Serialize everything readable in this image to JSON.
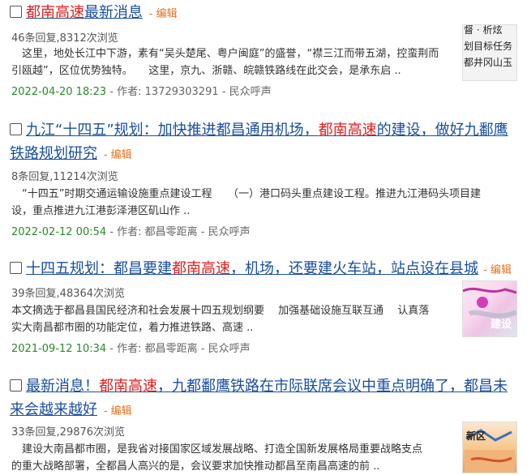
{
  "checkbox_icon": "checkbox-icon",
  "items": [
    {
      "title_parts": [
        "都南高速",
        "最新消息"
      ],
      "edit": "编辑",
      "stats": "46条回复,8312次浏览",
      "excerpt_lines": [
        "　这里，地处长江中下游，素有“吴头楚尾、粤户闽庭”的盛誉，“襟三江而带五湖，控蛮荆而",
        "引瓯越”，区位优势独特。　　这里，京九、浙赣、皖赣铁路线在此交会，是承东启 .."
      ],
      "date": "2022-04-20 18:23",
      "meta_rest": "- 作者: 13729303291 - 民众呼声",
      "thumb_text": [
        "督 · 析炫",
        "划目标任务",
        "都井冈山玉"
      ]
    },
    {
      "title_lines": [
        "九江“十四五”规划：加快推进都昌通用机场，",
        "都南高速",
        "的建设，做好九鄱鹰",
        "铁路规划研究"
      ],
      "edit": "编辑",
      "stats": "8条回复,11214次浏览",
      "excerpt_lines": [
        "　“十四五”时期交通运输设施重点建设工程　　（一）港口码头重点建设工程。推进九江港码头项目建",
        "设，重点推进九江港彭泽港区矶山作 .."
      ],
      "date": "2022-02-12 00:54",
      "meta_rest": "- 作者: 都昌零距离 - 民众呼声"
    },
    {
      "title_parts": [
        "十四五规划：都昌要建",
        "都南高速",
        "，机场，还要建火车站，站点设在县城"
      ],
      "edit": "编辑",
      "stats": "39条回复,48364次浏览",
      "excerpt_lines": [
        "本文摘选于都昌县国民经济和社会发展十四五规划纲要　 加强基础设施互联互通　 认真落",
        "实大南昌都市圈的功能定位，着力推进铁路、高速 .."
      ],
      "date": "2021-09-12 10:34",
      "meta_rest": "- 作者: 都昌零距离 - 民众呼声",
      "thumb_text": [
        "建设"
      ]
    },
    {
      "title_lines": [
        "最新消息！",
        "都南高速",
        "，九都鄱鹰铁路在市际联席会议中重点明确了，都昌未",
        "来会越来越好"
      ],
      "edit": "编辑",
      "stats": "33条回复,29876次浏览",
      "excerpt_lines": [
        "　建设大南昌都市圈，是我省对接国家区域发展战略、打造全国新发展格局重要战略支点",
        "的重大战略部署，全都昌人高兴的是，会议要求加快推动都昌至南昌高速的前 .."
      ],
      "thumb_text": [
        "新区"
      ]
    }
  ]
}
